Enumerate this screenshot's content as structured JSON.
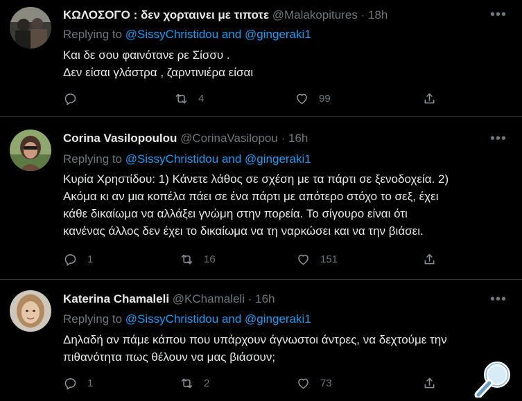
{
  "tweets": [
    {
      "name": "ΚΩΛΟΣΟΓΟ : δεν χορταινει με τιποτε",
      "handle": "@Malakopitures",
      "dot": "·",
      "time": "18h",
      "replying_prefix": "Replying to",
      "reply_user1": "@SissyChristidou",
      "reply_and": "and",
      "reply_user2": "@gingeraki1",
      "lines": [
        "Και δε σου φαινότανε ρε Σίσσυ .",
        "Δεν είσαι γλάστρα , ζαρντινιέρα είσαι"
      ],
      "replies": "",
      "retweets": "4",
      "likes": "99"
    },
    {
      "name": "Corina Vasilopoulou",
      "handle": "@CorinaVasilopou",
      "dot": "·",
      "time": "16h",
      "replying_prefix": "Replying to",
      "reply_user1": "@SissyChristidou",
      "reply_and": "and",
      "reply_user2": "@gingeraki1",
      "lines": [
        "Κυρία Χρηστίδου: 1) Κάνετε λάθος σε σχέση με τα πάρτι σε ξενοδοχεία. 2)",
        "Ακόμα κι αν μια κοπέλα πάει σε ένα πάρτι με απότερο στόχο το σεξ, έχει",
        "κάθε δικαίωμα να αλλάξει γνώμη στην πορεία. Το σίγουρο είναι ότι",
        "κανένας άλλος δεν έχει το δικαίωμα να τη ναρκώσει και να την βιάσει."
      ],
      "replies": "1",
      "retweets": "16",
      "likes": "151"
    },
    {
      "name": "Katerina Chamaleli",
      "handle": "@KChamaleli",
      "dot": "·",
      "time": "16h",
      "replying_prefix": "Replying to",
      "reply_user1": "@SissyChristidou",
      "reply_and": "and",
      "reply_user2": "@gingeraki1",
      "lines": [
        "Δηλαδή αν πάμε κάπου που υπάρχουν άγνωστοι άντρες, να δεχτούμε την",
        "πιθανότητα πως θέλουν να μας βιάσουν;"
      ],
      "replies": "1",
      "retweets": "2",
      "likes": "73"
    }
  ],
  "icons": {
    "reply": "reply-icon",
    "retweet": "retweet-icon",
    "like": "heart-icon",
    "share": "share-icon",
    "more": "more-icon",
    "zoom": "magnifier-icon"
  },
  "colors": {
    "background": "#000000",
    "text": "#e7e9ea",
    "muted": "#71767b",
    "link": "#1d9bf0",
    "divider": "#2f3336"
  }
}
